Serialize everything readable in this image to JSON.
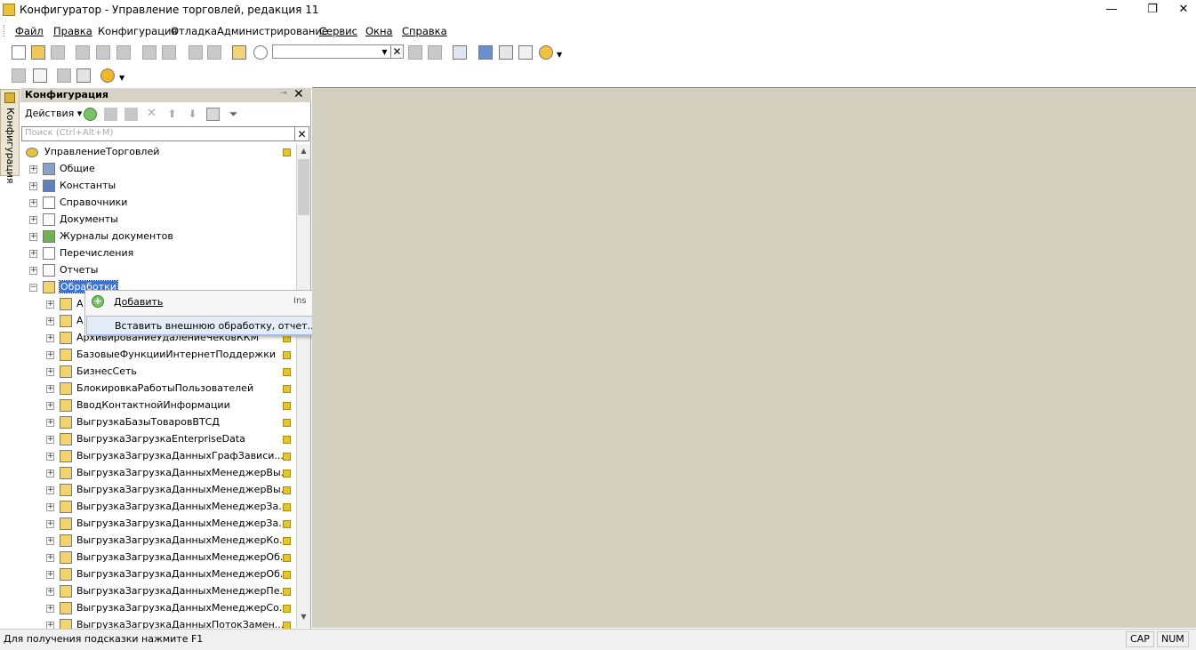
{
  "window": {
    "title": "Конфигуратор - Управление торговлей, редакция 11",
    "minimize": "—",
    "restore": "❐",
    "close": "✕"
  },
  "menu": [
    "Файл",
    "Правка",
    "Конфигурация",
    "Отладка",
    "Администрирование",
    "Сервис",
    "Окна",
    "Справка"
  ],
  "toolbar": {
    "search_value": ""
  },
  "side_tab": {
    "label": "Конфигурация"
  },
  "panel": {
    "title": "Конфигурация",
    "pin": "⊸",
    "close": "✕",
    "actions_label": "Действия",
    "search_placeholder": "Поиск (Ctrl+Alt+M)"
  },
  "tree": [
    {
      "label": "УправлениеТорговлей",
      "level": 0,
      "icon": "root-icon",
      "expander": "",
      "lock": true
    },
    {
      "label": "Общие",
      "level": 1,
      "icon": "common-icon",
      "expander": "+",
      "lock": false
    },
    {
      "label": "Константы",
      "level": 1,
      "icon": "constants-icon",
      "expander": "+",
      "lock": false
    },
    {
      "label": "Справочники",
      "level": 1,
      "icon": "catalogs-icon",
      "expander": "+",
      "lock": false
    },
    {
      "label": "Документы",
      "level": 1,
      "icon": "documents-icon",
      "expander": "+",
      "lock": false
    },
    {
      "label": "Журналы документов",
      "level": 1,
      "icon": "journals-icon",
      "expander": "+",
      "lock": false
    },
    {
      "label": "Перечисления",
      "level": 1,
      "icon": "enums-icon",
      "expander": "+",
      "lock": false
    },
    {
      "label": "Отчеты",
      "level": 1,
      "icon": "reports-icon",
      "expander": "+",
      "lock": false
    },
    {
      "label": "Обработки",
      "level": 1,
      "icon": "processing-icon",
      "expander": "−",
      "lock": false,
      "selected": true
    },
    {
      "label": "А",
      "level": 2,
      "icon": "processing-icon",
      "expander": "+",
      "lock": false
    },
    {
      "label": "А",
      "level": 2,
      "icon": "processing-icon",
      "expander": "+",
      "lock": false
    },
    {
      "label": "АрхивированиеУдалениеЧековККМ",
      "level": 2,
      "icon": "processing-icon",
      "expander": "+",
      "lock": true
    },
    {
      "label": "БазовыеФункцииИнтернетПоддержки",
      "level": 2,
      "icon": "processing-icon",
      "expander": "+",
      "lock": true
    },
    {
      "label": "БизнесСеть",
      "level": 2,
      "icon": "processing-icon",
      "expander": "+",
      "lock": true
    },
    {
      "label": "БлокировкаРаботыПользователей",
      "level": 2,
      "icon": "processing-icon",
      "expander": "+",
      "lock": true
    },
    {
      "label": "ВводКонтактнойИнформации",
      "level": 2,
      "icon": "processing-icon",
      "expander": "+",
      "lock": true
    },
    {
      "label": "ВыгрузкаБазыТоваровВТСД",
      "level": 2,
      "icon": "processing-icon",
      "expander": "+",
      "lock": true
    },
    {
      "label": "ВыгрузкаЗагрузкаEnterpriseData",
      "level": 2,
      "icon": "processing-icon",
      "expander": "+",
      "lock": true
    },
    {
      "label": "ВыгрузкаЗагрузкаДанныхГрафЗависи...",
      "level": 2,
      "icon": "processing-icon",
      "expander": "+",
      "lock": true
    },
    {
      "label": "ВыгрузкаЗагрузкаДанныхМенеджерВы...",
      "level": 2,
      "icon": "processing-icon",
      "expander": "+",
      "lock": true
    },
    {
      "label": "ВыгрузкаЗагрузкаДанныхМенеджерВы...",
      "level": 2,
      "icon": "processing-icon",
      "expander": "+",
      "lock": true
    },
    {
      "label": "ВыгрузкаЗагрузкаДанныхМенеджерЗа...",
      "level": 2,
      "icon": "processing-icon",
      "expander": "+",
      "lock": true
    },
    {
      "label": "ВыгрузкаЗагрузкаДанныхМенеджерЗа...",
      "level": 2,
      "icon": "processing-icon",
      "expander": "+",
      "lock": true
    },
    {
      "label": "ВыгрузкаЗагрузкаДанныхМенеджерКо...",
      "level": 2,
      "icon": "processing-icon",
      "expander": "+",
      "lock": true
    },
    {
      "label": "ВыгрузкаЗагрузкаДанныхМенеджерОб...",
      "level": 2,
      "icon": "processing-icon",
      "expander": "+",
      "lock": true
    },
    {
      "label": "ВыгрузкаЗагрузкаДанныхМенеджерОб...",
      "level": 2,
      "icon": "processing-icon",
      "expander": "+",
      "lock": true
    },
    {
      "label": "ВыгрузкаЗагрузкаДанныхМенеджерПе...",
      "level": 2,
      "icon": "processing-icon",
      "expander": "+",
      "lock": true
    },
    {
      "label": "ВыгрузкаЗагрузкаДанныхМенеджерСо...",
      "level": 2,
      "icon": "processing-icon",
      "expander": "+",
      "lock": true
    },
    {
      "label": "ВыгрузкаЗагрузкаДанныхПотокЗамен...",
      "level": 2,
      "icon": "processing-icon",
      "expander": "+",
      "lock": true
    }
  ],
  "context_menu": {
    "items": [
      {
        "label": "Добавить",
        "shortcut": "Ins",
        "icon": "add-icon"
      },
      {
        "label": "Вставить внешнюю обработку, отчет...",
        "shortcut": ""
      }
    ]
  },
  "status": {
    "hint": "Для получения подсказки нажмите F1",
    "cap": "CAP",
    "num": "NUM"
  },
  "colors": {
    "workspace": "#d4d0c0",
    "selection": "#3875d7",
    "panel_header": "#d6d3c6"
  }
}
